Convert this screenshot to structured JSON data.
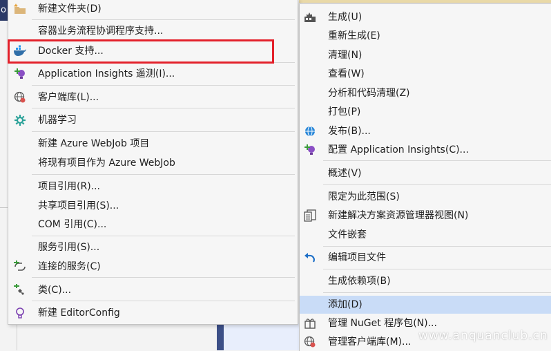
{
  "background": {
    "corner_text": "o"
  },
  "left_menu": {
    "new_folder": "新建文件夹(D)",
    "container_orchestration": "容器业务流程协调程序支持...",
    "docker_support": "Docker 支持...",
    "app_insights_telemetry": "Application Insights 遥测(I)...",
    "client_library": "客户端库(L)...",
    "machine_learning": "机器学习",
    "new_azure_webjob": "新建 Azure WebJob 项目",
    "existing_as_webjob": "将现有项目作为 Azure WebJob",
    "project_reference": "项目引用(R)...",
    "shared_project_reference": "共享项目引用(S)...",
    "com_reference": "COM 引用(C)...",
    "service_reference": "服务引用(S)...",
    "connected_services": "连接的服务(C)",
    "class": "类(C)...",
    "new_editorconfig": "新建 EditorConfig"
  },
  "right_menu": {
    "build": "生成(U)",
    "rebuild": "重新生成(E)",
    "clean": "清理(N)",
    "view": "查看(W)",
    "analyze": "分析和代码清理(Z)",
    "pack": "打包(P)",
    "publish": "发布(B)...",
    "configure_app_insights": "配置 Application Insights(C)...",
    "overview": "概述(V)",
    "scope_to_this": "限定为此范围(S)",
    "new_solution_explorer_view": "新建解决方案资源管理器视图(N)",
    "file_nesting": "文件嵌套",
    "edit_project_file": "编辑项目文件",
    "build_dependencies": "生成依赖项(B)",
    "add": "添加(D)",
    "manage_nuget": "管理 NuGet 程序包(N)...",
    "manage_client_libraries": "管理客户端库(M)..."
  },
  "watermark": "www.anquanclub.cn",
  "colors": {
    "highlight": "#c9dcf7",
    "annotation_red": "#e3202a",
    "menu_bg": "#f6f6f6"
  }
}
